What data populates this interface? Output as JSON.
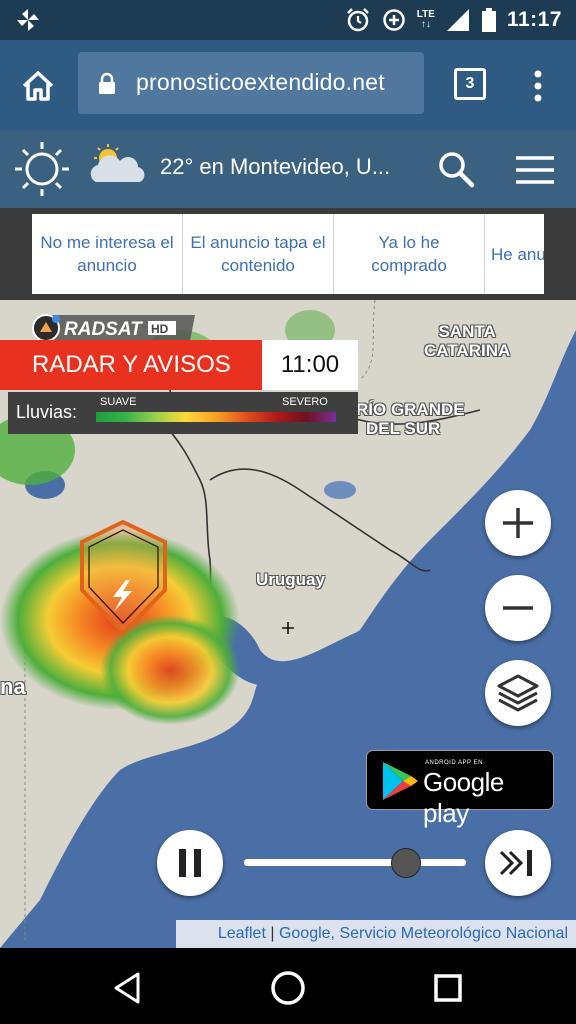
{
  "status_bar": {
    "time": "11:17",
    "network": "LTE",
    "icons": [
      "pinwheel-icon",
      "alarm-icon",
      "data-saver-icon",
      "signal-icon",
      "battery-icon"
    ]
  },
  "browser": {
    "url": "pronosticoextendido.net",
    "tab_count": "3"
  },
  "site_header": {
    "title": "22° en Montevideo, U..."
  },
  "ad_feedback": {
    "options": [
      "No me interesa el anuncio",
      "El anuncio tapa el contenido",
      "Ya lo he comprado",
      "He anun"
    ]
  },
  "map": {
    "labels": {
      "santa_catarina": "SANTA\nCATARINA",
      "rio_grande": "RÍO GRANDE\nDEL SUR",
      "uruguay": "Uruguay",
      "left_edge": "na"
    },
    "logo_text": "RADSAT HD",
    "radar_label": "RADAR Y AVISOS",
    "radar_time": "11:00",
    "legend": {
      "label": "Lluvias:",
      "low": "SUAVE",
      "high": "SEVERO"
    },
    "zoom_in": "+",
    "zoom_out": "−",
    "google_play_small": "ANDROID APP EN",
    "google_play_big": "Google play",
    "attribution": {
      "leaflet": "Leaflet",
      "separator": " | ",
      "sources": "Google, Servicio Meteorológico Nacional"
    },
    "slider_progress": 0.73
  },
  "colors": {
    "status_bar": "#1e3b54",
    "url_bar": "#2f5b82",
    "site_bar": "#3a6180",
    "radar_red": "#e8321f",
    "link_blue": "#3d6fb6"
  }
}
